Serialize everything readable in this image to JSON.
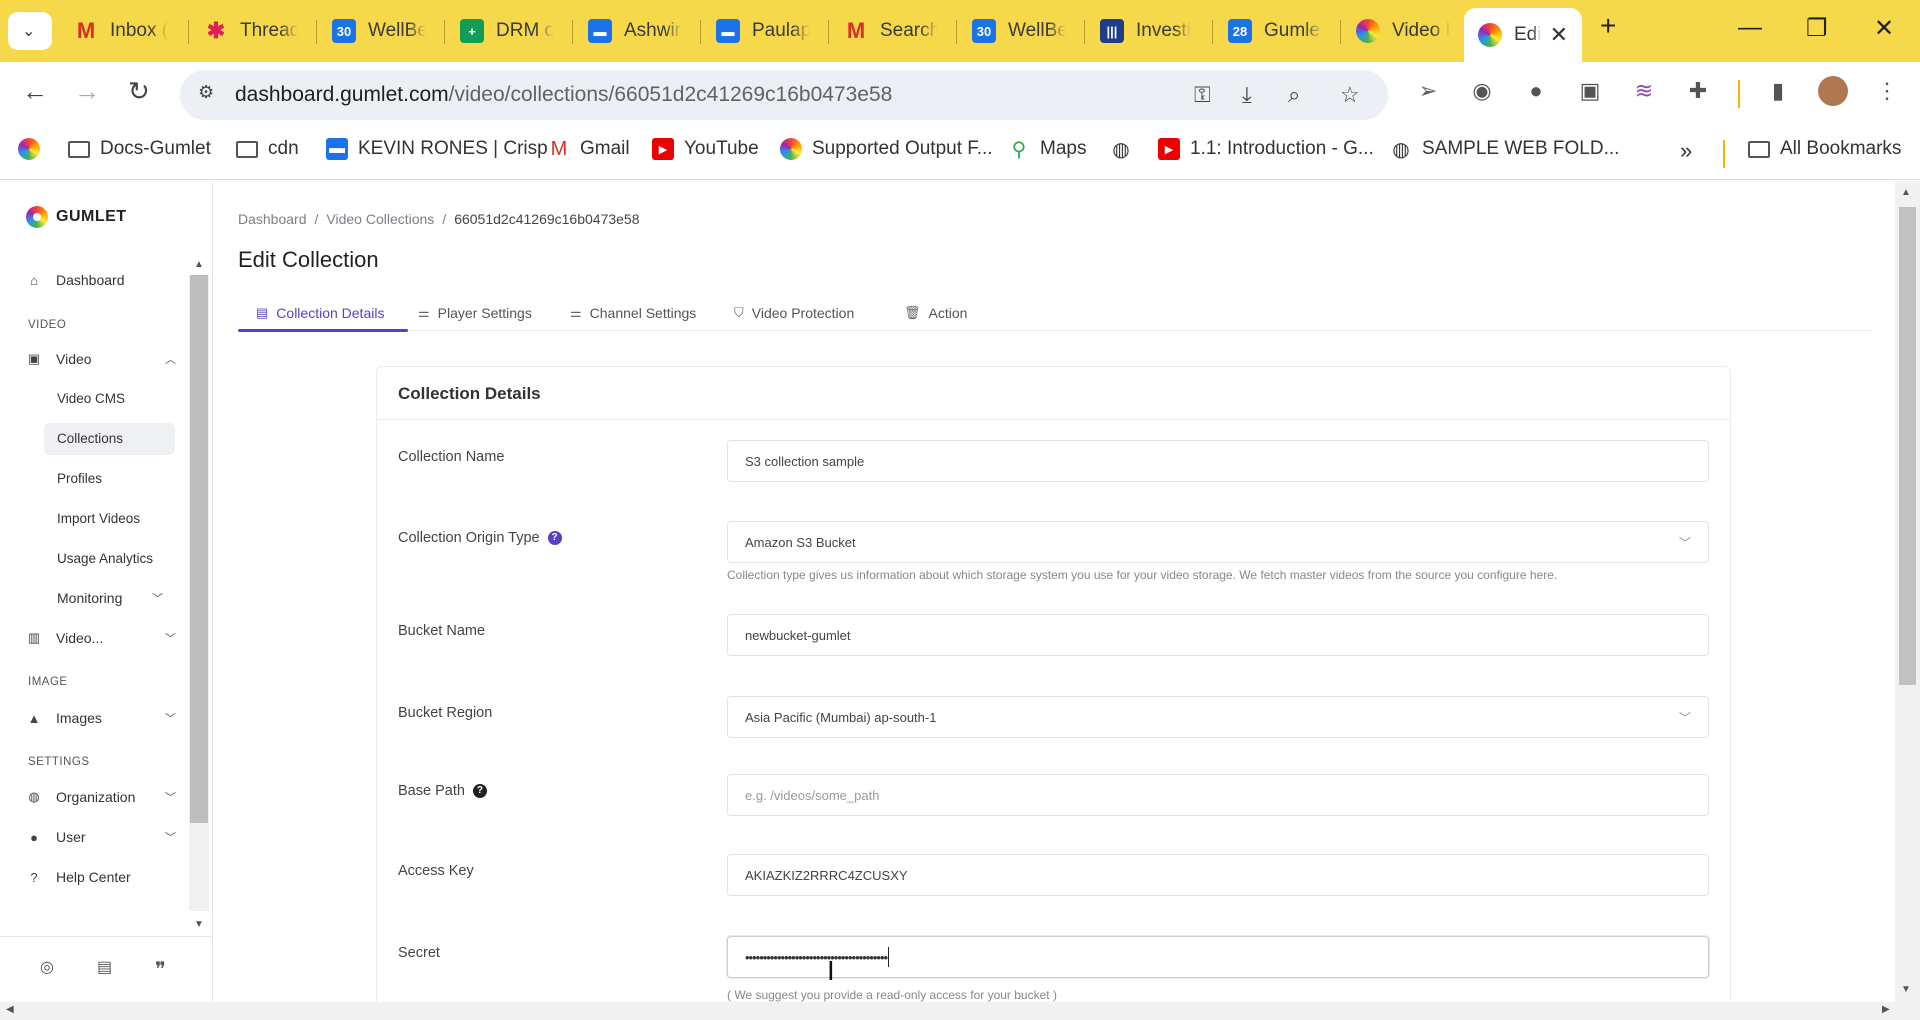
{
  "browser": {
    "tabs": [
      {
        "title": "Inbox (",
        "icon": "gmail-icon",
        "color": "#d93025"
      },
      {
        "title": "Thread",
        "icon": "slack-icon",
        "color": "#e01e5a"
      },
      {
        "title": "WellBe",
        "icon": "calendar-icon",
        "color": "#1a73e8"
      },
      {
        "title": "DRM c",
        "icon": "sheets-icon",
        "color": "#0f9d58"
      },
      {
        "title": "Ashwin",
        "icon": "chat-icon",
        "color": "#1a73e8"
      },
      {
        "title": "Paulap",
        "icon": "chat-icon",
        "color": "#1a73e8"
      },
      {
        "title": "Search",
        "icon": "gmail-icon",
        "color": "#d93025"
      },
      {
        "title": "WellBe",
        "icon": "calendar-icon",
        "color": "#1a73e8"
      },
      {
        "title": "Investi",
        "icon": "intercom-icon",
        "color": "#1f3c88"
      },
      {
        "title": "Gumlet",
        "icon": "calendar-icon",
        "color": "#1a73e8"
      },
      {
        "title": "Video F",
        "icon": "gumlet-icon",
        "color": "#e67e22"
      },
      {
        "title": "Edi",
        "icon": "gumlet-icon",
        "color": "#e67e22"
      }
    ],
    "url_host": "dashboard.gumlet.com",
    "url_path": "/video/collections/66051d2c41269c16b0473e58",
    "bookmarks": [
      {
        "label": "Docs-Gumlet",
        "type": "folder"
      },
      {
        "label": "cdn",
        "type": "folder"
      },
      {
        "label": "KEVIN RONES | Crisp",
        "type": "site"
      },
      {
        "label": "Gmail",
        "type": "site"
      },
      {
        "label": "YouTube",
        "type": "site"
      },
      {
        "label": "Supported Output F...",
        "type": "site"
      },
      {
        "label": "Maps",
        "type": "site"
      },
      {
        "label": "1.1: Introduction - G...",
        "type": "site"
      },
      {
        "label": "SAMPLE WEB FOLD...",
        "type": "site"
      }
    ],
    "all_bookmarks": "All Bookmarks"
  },
  "sidebar": {
    "brand": "GUMLET",
    "dashboard": "Dashboard",
    "section_video": "VIDEO",
    "video": "Video",
    "sub_items": [
      "Video CMS",
      "Collections",
      "Profiles",
      "Import Videos",
      "Usage Analytics",
      "Monitoring"
    ],
    "video_analytics": "Video...",
    "section_image": "IMAGE",
    "images": "Images",
    "section_settings": "SETTINGS",
    "organization": "Organization",
    "user": "User",
    "help_center": "Help Center"
  },
  "page": {
    "breadcrumb": [
      "Dashboard",
      "Video Collections",
      "66051d2c41269c16b0473e58"
    ],
    "title": "Edit Collection",
    "tabs": [
      "Collection Details",
      "Player Settings",
      "Channel Settings",
      "Video Protection",
      "Action"
    ],
    "accent": "#5b3fc4"
  },
  "form": {
    "card_title": "Collection Details",
    "collection_name_label": "Collection Name",
    "collection_name_value": "S3 collection sample",
    "origin_type_label": "Collection Origin Type",
    "origin_type_value": "Amazon S3 Bucket",
    "origin_type_hint": "Collection type gives us information about which storage system you use for your video storage. We fetch master videos from the source you configure here.",
    "bucket_name_label": "Bucket Name",
    "bucket_name_value": "newbucket-gumlet",
    "bucket_region_label": "Bucket Region",
    "bucket_region_value": "Asia Pacific (Mumbai) ap-south-1",
    "base_path_label": "Base Path",
    "base_path_placeholder": "e.g. /videos/some_path",
    "access_key_label": "Access Key",
    "access_key_value": "AKIAZKIZ2RRRC4ZCUSXY",
    "secret_label": "Secret",
    "secret_value": "••••••••••••••••••••••••••••••••••••••••",
    "secret_hint": "( We suggest you provide a read-only access for your bucket )"
  }
}
